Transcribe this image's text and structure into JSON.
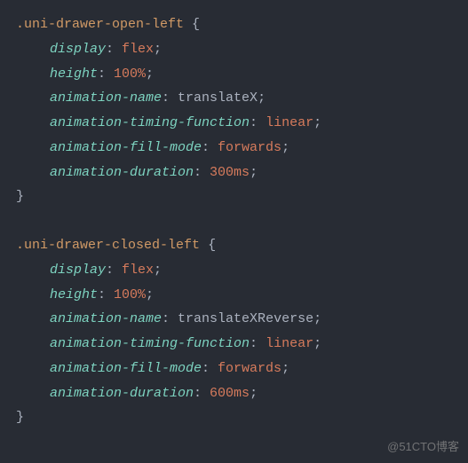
{
  "rules": [
    {
      "selector": ".uni-drawer-open-left",
      "declarations": [
        {
          "property": "display",
          "value": "flex",
          "valueType": "keyword"
        },
        {
          "property": "height",
          "value": "100%",
          "valueType": "keyword"
        },
        {
          "property": "animation-name",
          "value": "translateX",
          "valueType": "ident"
        },
        {
          "property": "animation-timing-function",
          "value": "linear",
          "valueType": "keyword"
        },
        {
          "property": "animation-fill-mode",
          "value": "forwards",
          "valueType": "keyword"
        },
        {
          "property": "animation-duration",
          "value": "300ms",
          "valueType": "keyword"
        }
      ]
    },
    {
      "selector": ".uni-drawer-closed-left",
      "declarations": [
        {
          "property": "display",
          "value": "flex",
          "valueType": "keyword"
        },
        {
          "property": "height",
          "value": "100%",
          "valueType": "keyword"
        },
        {
          "property": "animation-name",
          "value": "translateXReverse",
          "valueType": "ident"
        },
        {
          "property": "animation-timing-function",
          "value": "linear",
          "valueType": "keyword"
        },
        {
          "property": "animation-fill-mode",
          "value": "forwards",
          "valueType": "keyword"
        },
        {
          "property": "animation-duration",
          "value": "600ms",
          "valueType": "keyword"
        }
      ]
    }
  ],
  "watermark": "@51CTO博客"
}
